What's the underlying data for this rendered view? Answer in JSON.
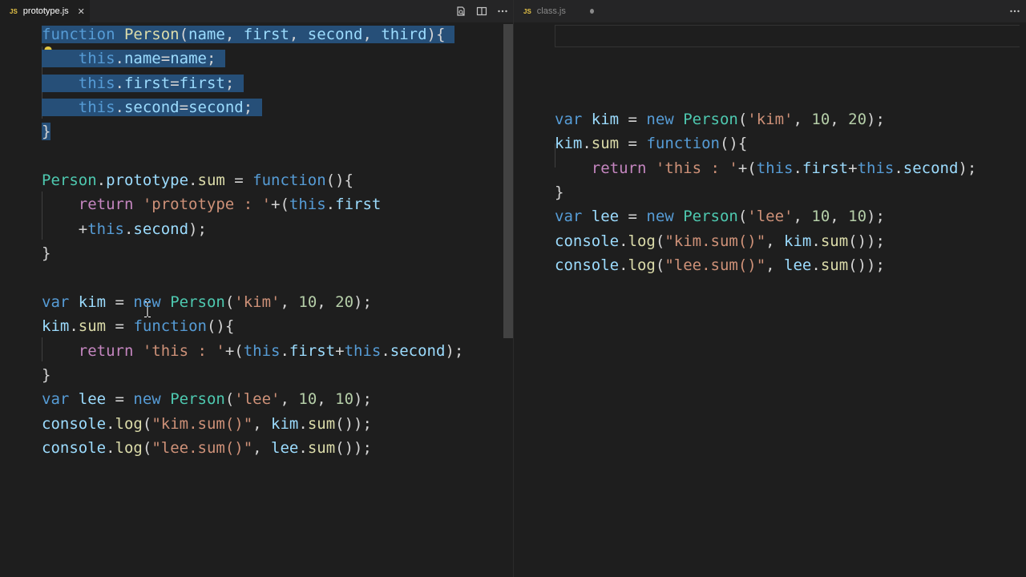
{
  "left_pane": {
    "tab": {
      "badge": "JS",
      "title": "prototype.js",
      "close": "✕"
    },
    "actions": [
      "open-changes-icon",
      "split-editor-icon",
      "more-actions-icon"
    ],
    "lines": [
      [
        [
          "kw",
          "function "
        ],
        [
          "fn",
          "Person"
        ],
        [
          "",
          "("
        ],
        [
          "var",
          "name"
        ],
        [
          "",
          ", "
        ],
        [
          "var",
          "first"
        ],
        [
          "",
          ", "
        ],
        [
          "var",
          "second"
        ],
        [
          "",
          ", "
        ],
        [
          "var",
          "third"
        ],
        [
          "",
          "){"
        ]
      ],
      [
        [
          "",
          "    "
        ],
        [
          "kw",
          "this"
        ],
        [
          "",
          "."
        ],
        [
          "var",
          "name"
        ],
        [
          "",
          "="
        ],
        [
          "var",
          "name"
        ],
        [
          "",
          ";"
        ]
      ],
      [
        [
          "",
          "    "
        ],
        [
          "kw",
          "this"
        ],
        [
          "",
          "."
        ],
        [
          "var",
          "first"
        ],
        [
          "",
          "="
        ],
        [
          "var",
          "first"
        ],
        [
          "",
          ";"
        ]
      ],
      [
        [
          "",
          "    "
        ],
        [
          "kw",
          "this"
        ],
        [
          "",
          "."
        ],
        [
          "var",
          "second"
        ],
        [
          "",
          "="
        ],
        [
          "var",
          "second"
        ],
        [
          "",
          ";"
        ]
      ],
      [
        [
          "",
          "}"
        ]
      ],
      [],
      [
        [
          "cls",
          "Person"
        ],
        [
          "",
          "."
        ],
        [
          "var",
          "prototype"
        ],
        [
          "",
          "."
        ],
        [
          "fn",
          "sum"
        ],
        [
          "",
          " = "
        ],
        [
          "kw",
          "function"
        ],
        [
          "",
          "(){"
        ]
      ],
      [
        [
          "",
          "    "
        ],
        [
          "ctl",
          "return"
        ],
        [
          "",
          " "
        ],
        [
          "str",
          "'prototype : '"
        ],
        [
          "",
          "+("
        ],
        [
          "kw",
          "this"
        ],
        [
          "",
          "."
        ],
        [
          "var",
          "first"
        ]
      ],
      [
        [
          "",
          "    +"
        ],
        [
          "kw",
          "this"
        ],
        [
          "",
          "."
        ],
        [
          "var",
          "second"
        ],
        [
          "",
          ");"
        ]
      ],
      [
        [
          "",
          "}"
        ]
      ],
      [],
      [
        [
          "kw",
          "var "
        ],
        [
          "var",
          "kim"
        ],
        [
          "",
          " = "
        ],
        [
          "kw",
          "new "
        ],
        [
          "cls",
          "Person"
        ],
        [
          "",
          "("
        ],
        [
          "str",
          "'kim'"
        ],
        [
          "",
          ", "
        ],
        [
          "num",
          "10"
        ],
        [
          "",
          ", "
        ],
        [
          "num",
          "20"
        ],
        [
          "",
          ");"
        ]
      ],
      [
        [
          "var",
          "kim"
        ],
        [
          "",
          "."
        ],
        [
          "fn",
          "sum"
        ],
        [
          "",
          " = "
        ],
        [
          "kw",
          "function"
        ],
        [
          "",
          "(){"
        ]
      ],
      [
        [
          "",
          "    "
        ],
        [
          "ctl",
          "return"
        ],
        [
          "",
          " "
        ],
        [
          "str",
          "'this : '"
        ],
        [
          "",
          "+("
        ],
        [
          "kw",
          "this"
        ],
        [
          "",
          "."
        ],
        [
          "var",
          "first"
        ],
        [
          "",
          "+"
        ],
        [
          "kw",
          "this"
        ],
        [
          "",
          "."
        ],
        [
          "var",
          "second"
        ],
        [
          "",
          ");"
        ]
      ],
      [
        [
          "",
          "}"
        ]
      ],
      [
        [
          "kw",
          "var "
        ],
        [
          "var",
          "lee"
        ],
        [
          "",
          " = "
        ],
        [
          "kw",
          "new "
        ],
        [
          "cls",
          "Person"
        ],
        [
          "",
          "("
        ],
        [
          "str",
          "'lee'"
        ],
        [
          "",
          ", "
        ],
        [
          "num",
          "10"
        ],
        [
          "",
          ", "
        ],
        [
          "num",
          "10"
        ],
        [
          "",
          ");"
        ]
      ],
      [
        [
          "var",
          "console"
        ],
        [
          "",
          "."
        ],
        [
          "fn",
          "log"
        ],
        [
          "",
          "("
        ],
        [
          "str",
          "\"kim.sum()\""
        ],
        [
          "",
          ", "
        ],
        [
          "var",
          "kim"
        ],
        [
          "",
          "."
        ],
        [
          "fn",
          "sum"
        ],
        [
          "",
          "());"
        ]
      ],
      [
        [
          "var",
          "console"
        ],
        [
          "",
          "."
        ],
        [
          "fn",
          "log"
        ],
        [
          "",
          "("
        ],
        [
          "str",
          "\"lee.sum()\""
        ],
        [
          "",
          ", "
        ],
        [
          "var",
          "lee"
        ],
        [
          "",
          "."
        ],
        [
          "fn",
          "sum"
        ],
        [
          "",
          "());"
        ]
      ]
    ]
  },
  "right_pane": {
    "tab": {
      "badge": "JS",
      "title": "class.js"
    },
    "actions": [
      "more-actions-icon"
    ],
    "lines": [
      [],
      [],
      [],
      [
        [
          "kw",
          "var "
        ],
        [
          "var",
          "kim"
        ],
        [
          "",
          " = "
        ],
        [
          "kw",
          "new "
        ],
        [
          "cls",
          "Person"
        ],
        [
          "",
          "("
        ],
        [
          "str",
          "'kim'"
        ],
        [
          "",
          ", "
        ],
        [
          "num",
          "10"
        ],
        [
          "",
          ", "
        ],
        [
          "num",
          "20"
        ],
        [
          "",
          ");"
        ]
      ],
      [
        [
          "var",
          "kim"
        ],
        [
          "",
          "."
        ],
        [
          "fn",
          "sum"
        ],
        [
          "",
          " = "
        ],
        [
          "kw",
          "function"
        ],
        [
          "",
          "(){"
        ]
      ],
      [
        [
          "",
          "    "
        ],
        [
          "ctl",
          "return"
        ],
        [
          "",
          " "
        ],
        [
          "str",
          "'this : '"
        ],
        [
          "",
          "+("
        ],
        [
          "kw",
          "this"
        ],
        [
          "",
          "."
        ],
        [
          "var",
          "first"
        ],
        [
          "",
          "+"
        ],
        [
          "kw",
          "this"
        ],
        [
          "",
          "."
        ],
        [
          "var",
          "second"
        ],
        [
          "",
          ");"
        ]
      ],
      [
        [
          "",
          "}"
        ]
      ],
      [
        [
          "kw",
          "var "
        ],
        [
          "var",
          "lee"
        ],
        [
          "",
          " = "
        ],
        [
          "kw",
          "new "
        ],
        [
          "cls",
          "Person"
        ],
        [
          "",
          "("
        ],
        [
          "str",
          "'lee'"
        ],
        [
          "",
          ", "
        ],
        [
          "num",
          "10"
        ],
        [
          "",
          ", "
        ],
        [
          "num",
          "10"
        ],
        [
          "",
          ");"
        ]
      ],
      [
        [
          "var",
          "console"
        ],
        [
          "",
          "."
        ],
        [
          "fn",
          "log"
        ],
        [
          "",
          "("
        ],
        [
          "str",
          "\"kim.sum()\""
        ],
        [
          "",
          ", "
        ],
        [
          "var",
          "kim"
        ],
        [
          "",
          "."
        ],
        [
          "fn",
          "sum"
        ],
        [
          "",
          "());"
        ]
      ],
      [
        [
          "var",
          "console"
        ],
        [
          "",
          "."
        ],
        [
          "fn",
          "log"
        ],
        [
          "",
          "("
        ],
        [
          "str",
          "\"lee.sum()\""
        ],
        [
          "",
          ", "
        ],
        [
          "var",
          "lee"
        ],
        [
          "",
          "."
        ],
        [
          "fn",
          "sum"
        ],
        [
          "",
          "());"
        ]
      ]
    ]
  },
  "colors": {
    "background": "#1e1e1e",
    "selection": "#264f78",
    "keyword": "#569cd6",
    "function": "#dcdcaa",
    "class": "#4ec9b0",
    "string": "#ce9178",
    "number": "#b5cea8",
    "control": "#c586c0",
    "variable": "#9cdcfe",
    "js_badge": "#e8c547"
  },
  "selection": {
    "pane": "left",
    "from_line": 1,
    "to_line": 5
  },
  "lightbulb_icon": "lightbulb-icon",
  "cursor": "text-cursor"
}
